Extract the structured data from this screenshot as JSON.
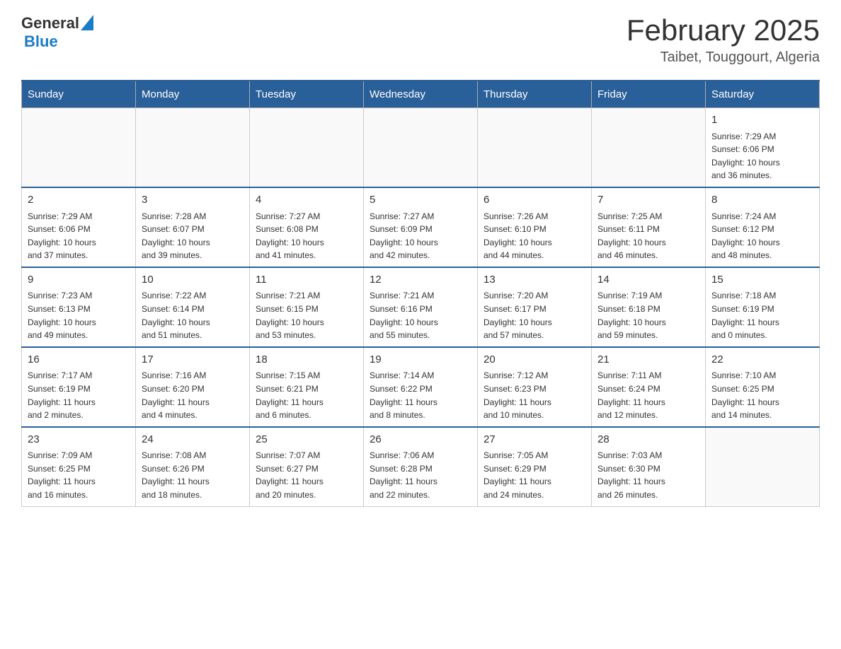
{
  "header": {
    "logo_general": "General",
    "logo_blue": "Blue",
    "title": "February 2025",
    "subtitle": "Taibet, Touggourt, Algeria"
  },
  "weekdays": [
    "Sunday",
    "Monday",
    "Tuesday",
    "Wednesday",
    "Thursday",
    "Friday",
    "Saturday"
  ],
  "weeks": [
    [
      {
        "day": "",
        "info": ""
      },
      {
        "day": "",
        "info": ""
      },
      {
        "day": "",
        "info": ""
      },
      {
        "day": "",
        "info": ""
      },
      {
        "day": "",
        "info": ""
      },
      {
        "day": "",
        "info": ""
      },
      {
        "day": "1",
        "info": "Sunrise: 7:29 AM\nSunset: 6:06 PM\nDaylight: 10 hours\nand 36 minutes."
      }
    ],
    [
      {
        "day": "2",
        "info": "Sunrise: 7:29 AM\nSunset: 6:06 PM\nDaylight: 10 hours\nand 37 minutes."
      },
      {
        "day": "3",
        "info": "Sunrise: 7:28 AM\nSunset: 6:07 PM\nDaylight: 10 hours\nand 39 minutes."
      },
      {
        "day": "4",
        "info": "Sunrise: 7:27 AM\nSunset: 6:08 PM\nDaylight: 10 hours\nand 41 minutes."
      },
      {
        "day": "5",
        "info": "Sunrise: 7:27 AM\nSunset: 6:09 PM\nDaylight: 10 hours\nand 42 minutes."
      },
      {
        "day": "6",
        "info": "Sunrise: 7:26 AM\nSunset: 6:10 PM\nDaylight: 10 hours\nand 44 minutes."
      },
      {
        "day": "7",
        "info": "Sunrise: 7:25 AM\nSunset: 6:11 PM\nDaylight: 10 hours\nand 46 minutes."
      },
      {
        "day": "8",
        "info": "Sunrise: 7:24 AM\nSunset: 6:12 PM\nDaylight: 10 hours\nand 48 minutes."
      }
    ],
    [
      {
        "day": "9",
        "info": "Sunrise: 7:23 AM\nSunset: 6:13 PM\nDaylight: 10 hours\nand 49 minutes."
      },
      {
        "day": "10",
        "info": "Sunrise: 7:22 AM\nSunset: 6:14 PM\nDaylight: 10 hours\nand 51 minutes."
      },
      {
        "day": "11",
        "info": "Sunrise: 7:21 AM\nSunset: 6:15 PM\nDaylight: 10 hours\nand 53 minutes."
      },
      {
        "day": "12",
        "info": "Sunrise: 7:21 AM\nSunset: 6:16 PM\nDaylight: 10 hours\nand 55 minutes."
      },
      {
        "day": "13",
        "info": "Sunrise: 7:20 AM\nSunset: 6:17 PM\nDaylight: 10 hours\nand 57 minutes."
      },
      {
        "day": "14",
        "info": "Sunrise: 7:19 AM\nSunset: 6:18 PM\nDaylight: 10 hours\nand 59 minutes."
      },
      {
        "day": "15",
        "info": "Sunrise: 7:18 AM\nSunset: 6:19 PM\nDaylight: 11 hours\nand 0 minutes."
      }
    ],
    [
      {
        "day": "16",
        "info": "Sunrise: 7:17 AM\nSunset: 6:19 PM\nDaylight: 11 hours\nand 2 minutes."
      },
      {
        "day": "17",
        "info": "Sunrise: 7:16 AM\nSunset: 6:20 PM\nDaylight: 11 hours\nand 4 minutes."
      },
      {
        "day": "18",
        "info": "Sunrise: 7:15 AM\nSunset: 6:21 PM\nDaylight: 11 hours\nand 6 minutes."
      },
      {
        "day": "19",
        "info": "Sunrise: 7:14 AM\nSunset: 6:22 PM\nDaylight: 11 hours\nand 8 minutes."
      },
      {
        "day": "20",
        "info": "Sunrise: 7:12 AM\nSunset: 6:23 PM\nDaylight: 11 hours\nand 10 minutes."
      },
      {
        "day": "21",
        "info": "Sunrise: 7:11 AM\nSunset: 6:24 PM\nDaylight: 11 hours\nand 12 minutes."
      },
      {
        "day": "22",
        "info": "Sunrise: 7:10 AM\nSunset: 6:25 PM\nDaylight: 11 hours\nand 14 minutes."
      }
    ],
    [
      {
        "day": "23",
        "info": "Sunrise: 7:09 AM\nSunset: 6:25 PM\nDaylight: 11 hours\nand 16 minutes."
      },
      {
        "day": "24",
        "info": "Sunrise: 7:08 AM\nSunset: 6:26 PM\nDaylight: 11 hours\nand 18 minutes."
      },
      {
        "day": "25",
        "info": "Sunrise: 7:07 AM\nSunset: 6:27 PM\nDaylight: 11 hours\nand 20 minutes."
      },
      {
        "day": "26",
        "info": "Sunrise: 7:06 AM\nSunset: 6:28 PM\nDaylight: 11 hours\nand 22 minutes."
      },
      {
        "day": "27",
        "info": "Sunrise: 7:05 AM\nSunset: 6:29 PM\nDaylight: 11 hours\nand 24 minutes."
      },
      {
        "day": "28",
        "info": "Sunrise: 7:03 AM\nSunset: 6:30 PM\nDaylight: 11 hours\nand 26 minutes."
      },
      {
        "day": "",
        "info": ""
      }
    ]
  ]
}
